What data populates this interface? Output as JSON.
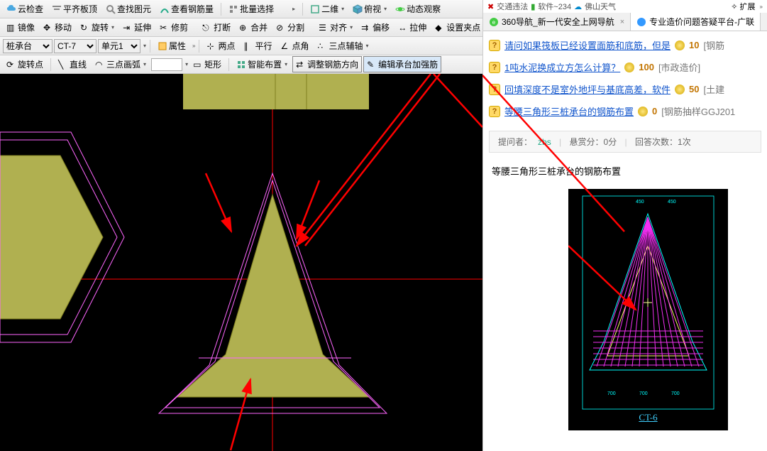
{
  "toolbars": {
    "row1": {
      "cloud_check": "云检查",
      "align_top": "平齐板顶",
      "find_elem": "查找图元",
      "view_rebar": "查看钢筋量",
      "batch_select": "批量选择",
      "view_2d": "二维",
      "top_view": "俯视",
      "dynamic_view": "动态观察"
    },
    "row2": {
      "mirror": "镜像",
      "move": "移动",
      "rotate": "旋转",
      "extend": "延伸",
      "trim": "修剪",
      "break": "打断",
      "merge": "合并",
      "split": "分割",
      "align": "对齐",
      "offset": "偏移",
      "stretch": "拉伸",
      "set_clip": "设置夹点"
    },
    "row3": {
      "sel_cap": "桩承台",
      "sel_ct7": "CT-7",
      "sel_unit": "单元1",
      "props": "属性",
      "two_pt": "两点",
      "parallel": "平行",
      "angle": "点角",
      "three_pt_aux": "三点辅轴"
    },
    "row4": {
      "rotate_pt": "旋转点",
      "line": "直线",
      "arc3pt": "三点画弧",
      "rect": "矩形",
      "smart_place": "智能布置",
      "adjust_rebar_dir": "调整钢筋方向",
      "edit_cap_rebar": "编辑承台加强筋"
    }
  },
  "right": {
    "addr": {
      "traffic": "交通违法",
      "soft": "软件~234",
      "weather": "佛山天气",
      "faves": "扩展"
    },
    "tab1": "360导航_新一代安全上网导航",
    "tab2": "专业造价问题答疑平台-广联",
    "qa": [
      {
        "text": "请问如果筏板已经设置面筋和底筋，但是",
        "pts": "10",
        "cat": "[钢筋"
      },
      {
        "text": "1吨水泥换成立方怎么计算？",
        "pts": "100",
        "cat": "[市政造价]"
      },
      {
        "text": "回填深度不是室外地坪与基底高差，软件",
        "pts": "50",
        "cat": "[土建"
      },
      {
        "text": "等腰三角形三桩承台的钢筋布置",
        "pts": "0",
        "cat": "[钢筋抽样GGJ201"
      }
    ],
    "meta": {
      "asker_label": "提问者：",
      "asker": "zbs",
      "bounty": "悬赏分：0分",
      "answers": "回答次数：1次"
    },
    "q_title": "等腰三角形三桩承台的钢筋布置",
    "ref_caption": "CT-6"
  }
}
